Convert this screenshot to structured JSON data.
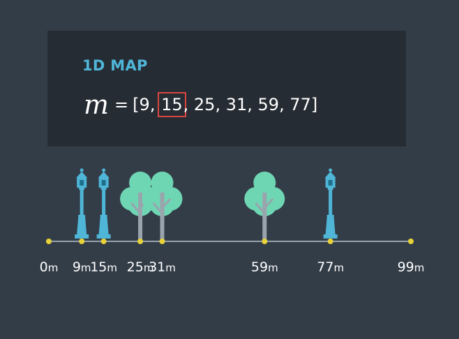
{
  "header": {
    "title": "1D MAP",
    "symbol": "m",
    "equals": "=",
    "open_bracket": "[",
    "close_bracket": "]",
    "values": [
      9,
      15,
      25,
      31,
      59,
      77
    ],
    "highlighted_value": 15,
    "highlight_color": "#d9473f"
  },
  "axis": {
    "unit": "m",
    "ticks": [
      0,
      9,
      15,
      25,
      31,
      59,
      77,
      99
    ],
    "min": 0,
    "max": 99,
    "dot_color": "#e8d23a",
    "line_color": "#9aa4ad"
  },
  "landmarks": [
    {
      "type": "lamp-post",
      "position": 9
    },
    {
      "type": "lamp-post",
      "position": 15
    },
    {
      "type": "tree",
      "position": 25
    },
    {
      "type": "tree",
      "position": 31
    },
    {
      "type": "tree",
      "position": 59
    },
    {
      "type": "lamp-post",
      "position": 77
    }
  ],
  "colors": {
    "background": "#333d48",
    "card": "#262c33",
    "title": "#4fb6d8",
    "tree": "#6fd6b4",
    "trunk": "#9aa4ad",
    "lamp": "#4fb6d8"
  }
}
